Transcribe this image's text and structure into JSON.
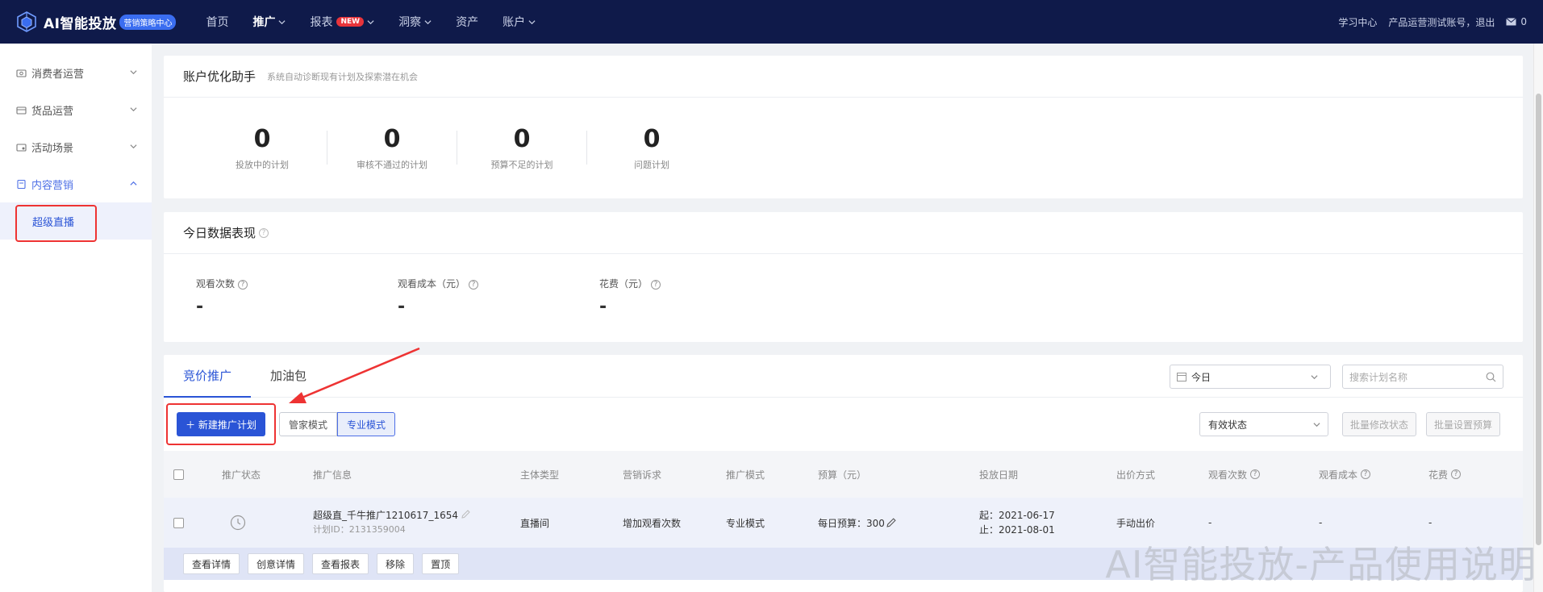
{
  "app": {
    "logo_text": "AI智能投放",
    "logo_badge": "营销策略中心"
  },
  "nav": {
    "items": [
      {
        "label": "首页"
      },
      {
        "label": "推广"
      },
      {
        "label": "报表",
        "badge": "NEW"
      },
      {
        "label": "洞察"
      },
      {
        "label": "资产"
      },
      {
        "label": "账户"
      }
    ],
    "active": "推广"
  },
  "topbar_right": {
    "learning": "学习中心",
    "account": "产品运营测试账号，退出",
    "message_count": "0"
  },
  "sidebar": {
    "items": [
      {
        "label": "消费者运营"
      },
      {
        "label": "货品运营"
      },
      {
        "label": "活动场景"
      },
      {
        "label": "内容营销"
      }
    ],
    "sub_item": "超级直播"
  },
  "optimizer": {
    "title": "账户优化助手",
    "subtitle": "系统自动诊断现有计划及探索潜在机会",
    "stats": [
      {
        "value": "0",
        "label": "投放中的计划"
      },
      {
        "value": "0",
        "label": "审核不通过的计划"
      },
      {
        "value": "0",
        "label": "预算不足的计划"
      },
      {
        "value": "0",
        "label": "问题计划"
      }
    ]
  },
  "today": {
    "title": "今日数据表现",
    "metrics": [
      {
        "label": "观看次数",
        "value": "-"
      },
      {
        "label": "观看成本（元）",
        "value": "-"
      },
      {
        "label": "花费（元）",
        "value": "-"
      }
    ]
  },
  "campaigns": {
    "tabs": [
      "竞价推广",
      "加油包"
    ],
    "date_value": "今日",
    "search_placeholder": "搜索计划名称",
    "new_button": "＋ 新建推广计划",
    "modes": [
      "管家模式",
      "专业模式"
    ],
    "status_select": "有效状态",
    "batch_status": "批量修改状态",
    "batch_budget": "批量设置预算",
    "columns": [
      "推广状态",
      "推广信息",
      "主体类型",
      "营销诉求",
      "推广模式",
      "预算（元）",
      "投放日期",
      "出价方式",
      "观看次数",
      "观看成本",
      "花费"
    ],
    "row": {
      "name": "超级直_千牛推广1210617_1654",
      "plan_id": "计划ID：2131359004",
      "subject": "直播间",
      "goal": "增加观看次数",
      "mode": "专业模式",
      "budget": "每日预算：300",
      "start": "起：2021-06-17",
      "end": "止：2021-08-01",
      "bid": "手动出价",
      "views": "-",
      "cost": "-",
      "spend": "-"
    },
    "row_actions": [
      "查看详情",
      "创意详情",
      "查看报表",
      "移除",
      "置顶"
    ]
  },
  "watermark": "AI智能投放-产品使用说明"
}
